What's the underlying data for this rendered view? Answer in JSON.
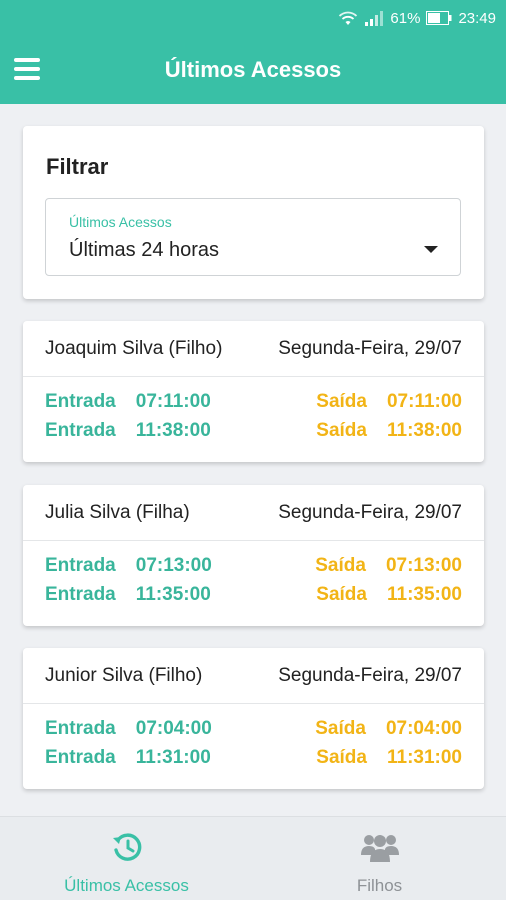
{
  "status_bar": {
    "battery_percent": "61%",
    "time": "23:49"
  },
  "app_bar": {
    "title": "Últimos Acessos"
  },
  "filter": {
    "title": "Filtrar",
    "select_label": "Últimos Acessos",
    "select_value": "Últimas 24 horas"
  },
  "accesses": [
    {
      "name": "Joaquim Silva (Filho)",
      "date": "Segunda-Feira, 29/07",
      "rows": [
        {
          "entry_label": "Entrada",
          "entry_time": "07:11:00",
          "exit_label": "Saída",
          "exit_time": "07:11:00"
        },
        {
          "entry_label": "Entrada",
          "entry_time": "11:38:00",
          "exit_label": "Saída",
          "exit_time": "11:38:00"
        }
      ]
    },
    {
      "name": "Julia Silva (Filha)",
      "date": "Segunda-Feira, 29/07",
      "rows": [
        {
          "entry_label": "Entrada",
          "entry_time": "07:13:00",
          "exit_label": "Saída",
          "exit_time": "07:13:00"
        },
        {
          "entry_label": "Entrada",
          "entry_time": "11:35:00",
          "exit_label": "Saída",
          "exit_time": "11:35:00"
        }
      ]
    },
    {
      "name": "Junior Silva (Filho)",
      "date": "Segunda-Feira, 29/07",
      "rows": [
        {
          "entry_label": "Entrada",
          "entry_time": "07:04:00",
          "exit_label": "Saída",
          "exit_time": "07:04:00"
        },
        {
          "entry_label": "Entrada",
          "entry_time": "11:31:00",
          "exit_label": "Saída",
          "exit_time": "11:31:00"
        }
      ]
    }
  ],
  "bottom_nav": [
    {
      "label": "Últimos Acessos",
      "icon": "history-icon",
      "active": true
    },
    {
      "label": "Filhos",
      "icon": "group-icon",
      "active": false
    }
  ],
  "colors": {
    "primary": "#39c0a6",
    "entry": "#39b59b",
    "exit": "#f2b416",
    "background": "#eef0f3"
  }
}
